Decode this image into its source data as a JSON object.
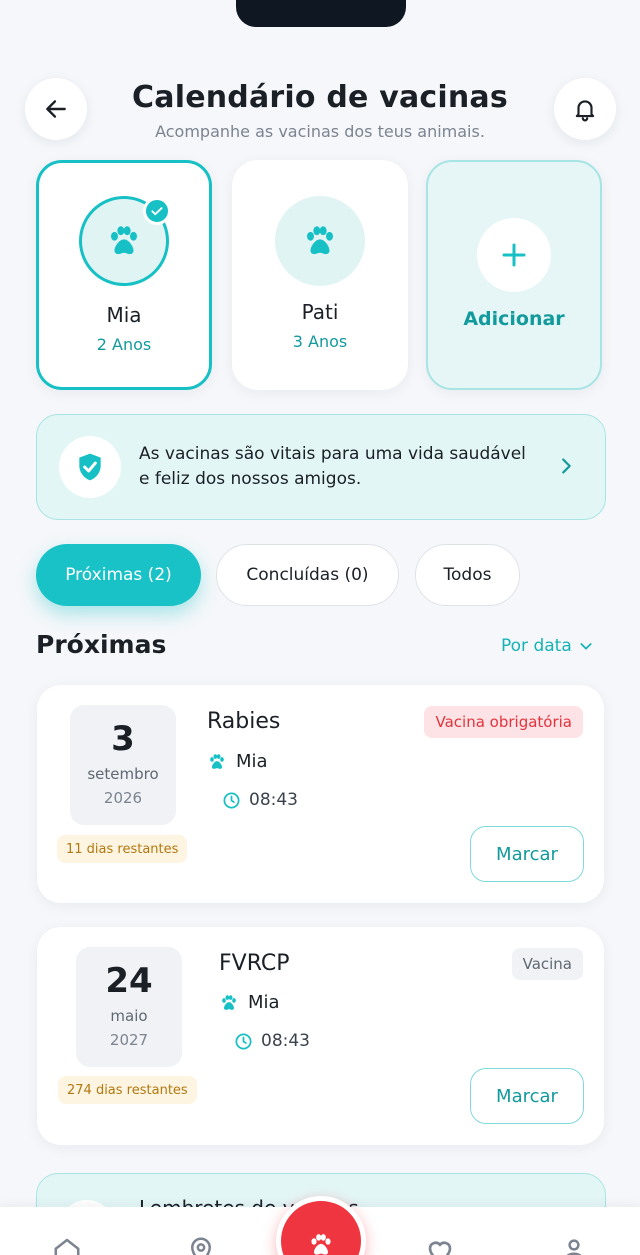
{
  "header": {
    "title": "Calendário de vacinas",
    "subtitle": "Acompanhe as vacinas dos teus animais."
  },
  "pets": [
    {
      "name": "Mia",
      "age": "2 Anos",
      "selected": true
    },
    {
      "name": "Pati",
      "age": "3 Anos",
      "selected": false
    }
  ],
  "add_pet_label": "Adicionar",
  "banner": {
    "text": "As vacinas são vitais para uma vida saudável e feliz dos nossos amigos."
  },
  "tabs": [
    {
      "label": "Próximas (2)",
      "active": true
    },
    {
      "label": "Concluídas (0)",
      "active": false
    },
    {
      "label": "Todos",
      "active": false
    }
  ],
  "section": {
    "title": "Próximas",
    "sort_label": "Por data"
  },
  "vaccines": [
    {
      "day": "3",
      "month": "setembro",
      "year": "2026",
      "days_left": "11 dias restantes",
      "name": "Rabies",
      "pet": "Mia",
      "time": "08:43",
      "badge": "Vacina obrigatória",
      "badge_type": "required",
      "action": "Marcar"
    },
    {
      "day": "24",
      "month": "maio",
      "year": "2027",
      "days_left": "274 dias restantes",
      "name": "FVRCP",
      "pet": "Mia",
      "time": "08:43",
      "badge": "Vacina",
      "badge_type": "normal",
      "action": "Marcar"
    }
  ],
  "reminder": {
    "title": "Lembretes de vacinas"
  },
  "colors": {
    "accent": "#19c2c6",
    "accent_dark": "#129a9c",
    "danger": "#ef3540",
    "warning_text": "#b3780f"
  },
  "icons": {
    "back": "arrow-left-icon",
    "notifications": "bell-icon",
    "pet": "paw-icon",
    "add": "plus-icon",
    "banner": "shield-check-icon",
    "time": "clock-icon",
    "nav": [
      "home-icon",
      "location-pin-icon",
      "paw-icon",
      "heart-icon",
      "profile-icon"
    ]
  }
}
